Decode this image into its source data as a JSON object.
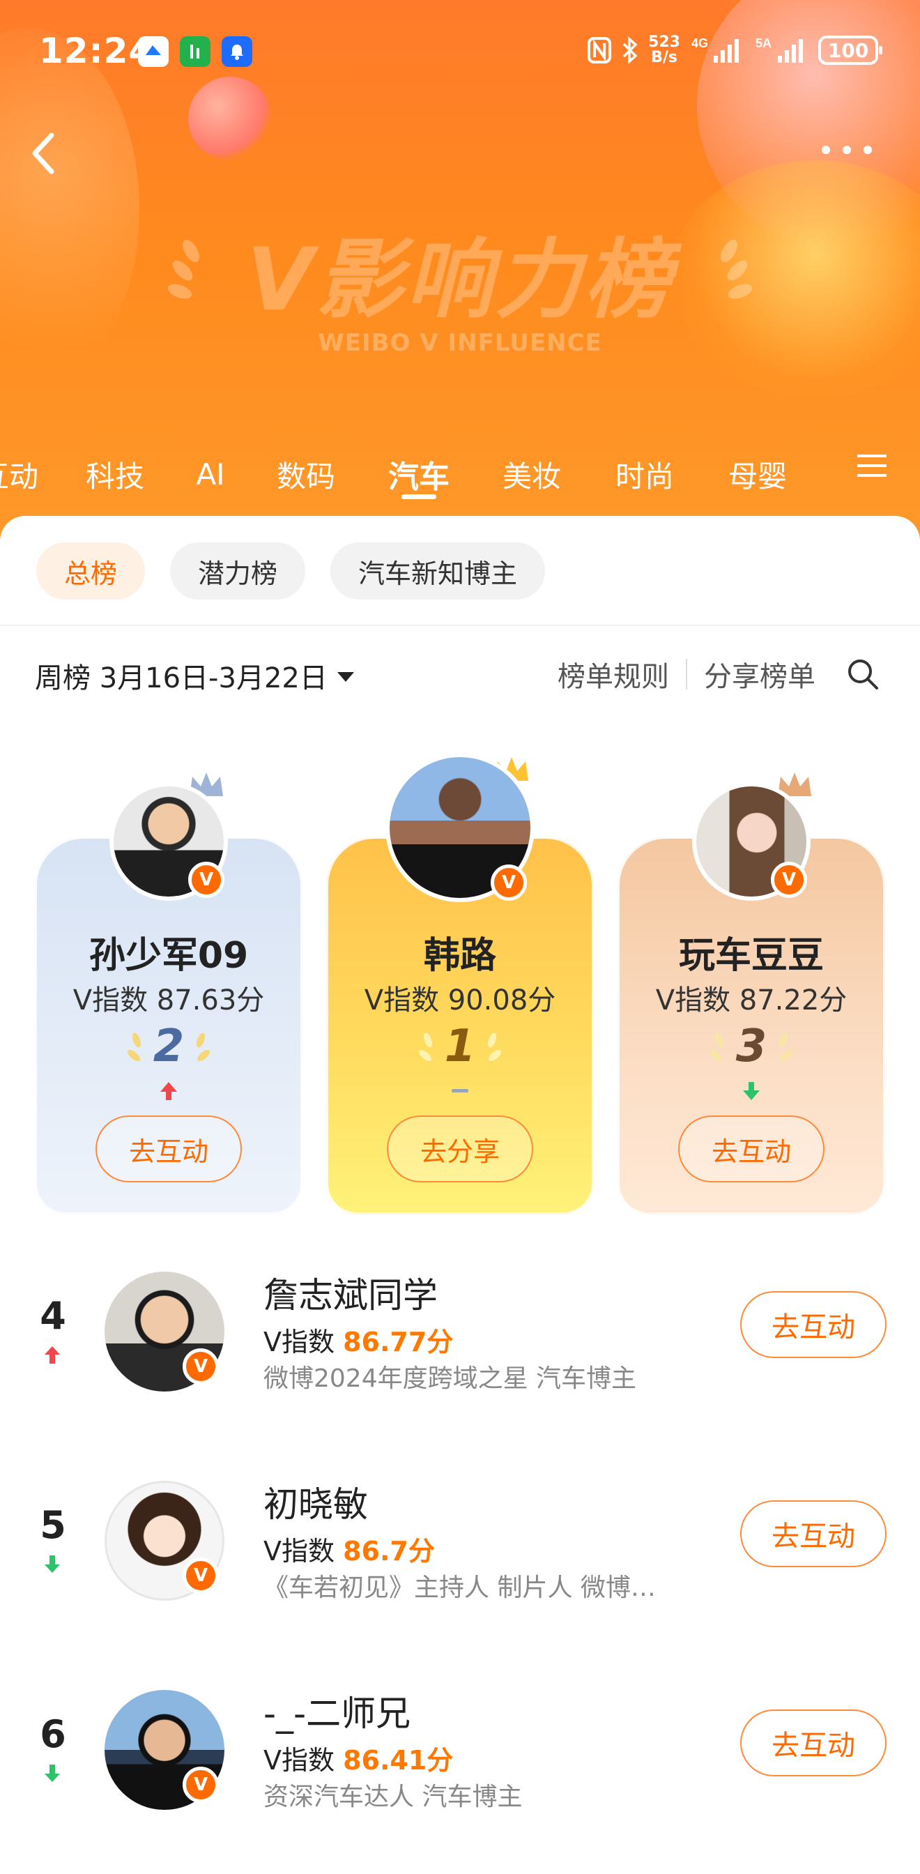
{
  "status_bar": {
    "time": "12:24",
    "net_speed_value": "523",
    "net_speed_unit": "B/s",
    "battery": "100"
  },
  "header": {
    "banner_title": "V影响力榜",
    "banner_subtitle": "WEIBO V INFLUENCE"
  },
  "tabs": [
    {
      "label": "互动"
    },
    {
      "label": "科技"
    },
    {
      "label": "AI"
    },
    {
      "label": "数码"
    },
    {
      "label": "汽车",
      "active": true
    },
    {
      "label": "美妆"
    },
    {
      "label": "时尚"
    },
    {
      "label": "母婴"
    }
  ],
  "sub_tabs": [
    {
      "label": "总榜",
      "active": true
    },
    {
      "label": "潜力榜"
    },
    {
      "label": "汽车新知博主"
    }
  ],
  "period": {
    "label": "周榜 3月16日-3月22日"
  },
  "tools": {
    "rules": "榜单规则",
    "share": "分享榜单"
  },
  "podium": [
    {
      "rank": "2",
      "name": "孙少军09",
      "index": "V指数 87.63分",
      "trend": "up",
      "button": "去互动",
      "color": "#4a6aa0"
    },
    {
      "rank": "1",
      "name": "韩路",
      "index": "V指数 90.08分",
      "trend": "flat",
      "button": "去分享",
      "color": "#8a5a10"
    },
    {
      "rank": "3",
      "name": "玩车豆豆",
      "index": "V指数 87.22分",
      "trend": "down",
      "button": "去互动",
      "color": "#6a4a30"
    }
  ],
  "list": [
    {
      "rank": "4",
      "name": "詹志斌同学",
      "index_label": "V指数 ",
      "index_value": "86.77分",
      "desc": "微博2024年度跨域之星 汽车博主",
      "trend": "up",
      "button": "去互动"
    },
    {
      "rank": "5",
      "name": "初晓敏",
      "index_label": "V指数 ",
      "index_value": "86.7分",
      "desc": "《车若初见》主持人 制片人 微博…",
      "trend": "down",
      "button": "去互动"
    },
    {
      "rank": "6",
      "name": "-_-二师兄",
      "index_label": "V指数 ",
      "index_value": "86.41分",
      "desc": "资深汽车达人 汽车博主",
      "trend": "down",
      "button": "去互动"
    }
  ],
  "colors": {
    "accent": "#ff6a00",
    "up": "#f0474a",
    "down": "#2ec36a"
  },
  "badge_letter": "V"
}
